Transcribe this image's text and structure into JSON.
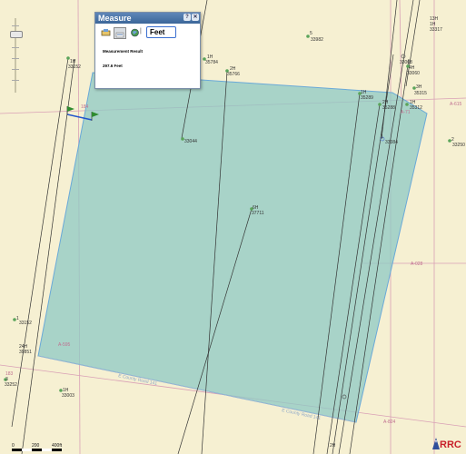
{
  "measure_widget": {
    "title": "Measure",
    "help_icon": "help-icon",
    "close_icon": "close-icon",
    "tools": [
      "measure-area-icon",
      "measure-distance-icon",
      "measure-location-icon"
    ],
    "unit": "Feet",
    "result_label": "Measurement Result",
    "result_value": "297.6 Feet"
  },
  "map": {
    "colors": {
      "background": "#f6f0d2",
      "measured_area_fill": "#8ec9c4",
      "measured_area_stroke": "#6aa9d8",
      "survey_lines": "#d9a0b6",
      "well_bore": "#333333",
      "well_symbol": "#5aa45a",
      "measure_line": "#2255cc",
      "flag": "#2e8b2e"
    },
    "survey_labels": [
      "A-615",
      "A-028",
      "A-595",
      "A-824",
      "183",
      "184",
      "A-71"
    ],
    "road_labels": [
      "E County Road 141",
      "E County Road 141"
    ],
    "well_labels": [
      {
        "id": "1H",
        "api": "33317"
      },
      {
        "id": "5",
        "api": "33982"
      },
      {
        "id": "1H",
        "api": "33152"
      },
      {
        "id": "4H",
        "api": "33060"
      },
      {
        "id": "1H",
        "api": "33008"
      },
      {
        "id": "3H",
        "api": "35315"
      },
      {
        "id": "2H",
        "api": "35766"
      },
      {
        "id": "1H",
        "api": "33044"
      },
      {
        "id": "1H",
        "api": "35289"
      },
      {
        "id": "2H",
        "api": "35288"
      },
      {
        "id": "1H",
        "api": "35312"
      },
      {
        "id": "1",
        "api": "33384"
      },
      {
        "id": "2",
        "api": "33250"
      },
      {
        "id": "6H",
        "api": "37711"
      },
      {
        "id": "1",
        "api": "33152"
      },
      {
        "id": "24H",
        "api": "39851"
      },
      {
        "id": "3",
        "api": "33252"
      },
      {
        "id": "1H",
        "api": "33003"
      },
      {
        "id": "1H",
        "api": "35784"
      },
      {
        "id": "13H",
        "api": ""
      },
      {
        "id": "2H",
        "api": ""
      }
    ],
    "scale_bar": {
      "ticks": [
        "0",
        "200",
        "400ft"
      ]
    },
    "logo_text": "RRC"
  }
}
